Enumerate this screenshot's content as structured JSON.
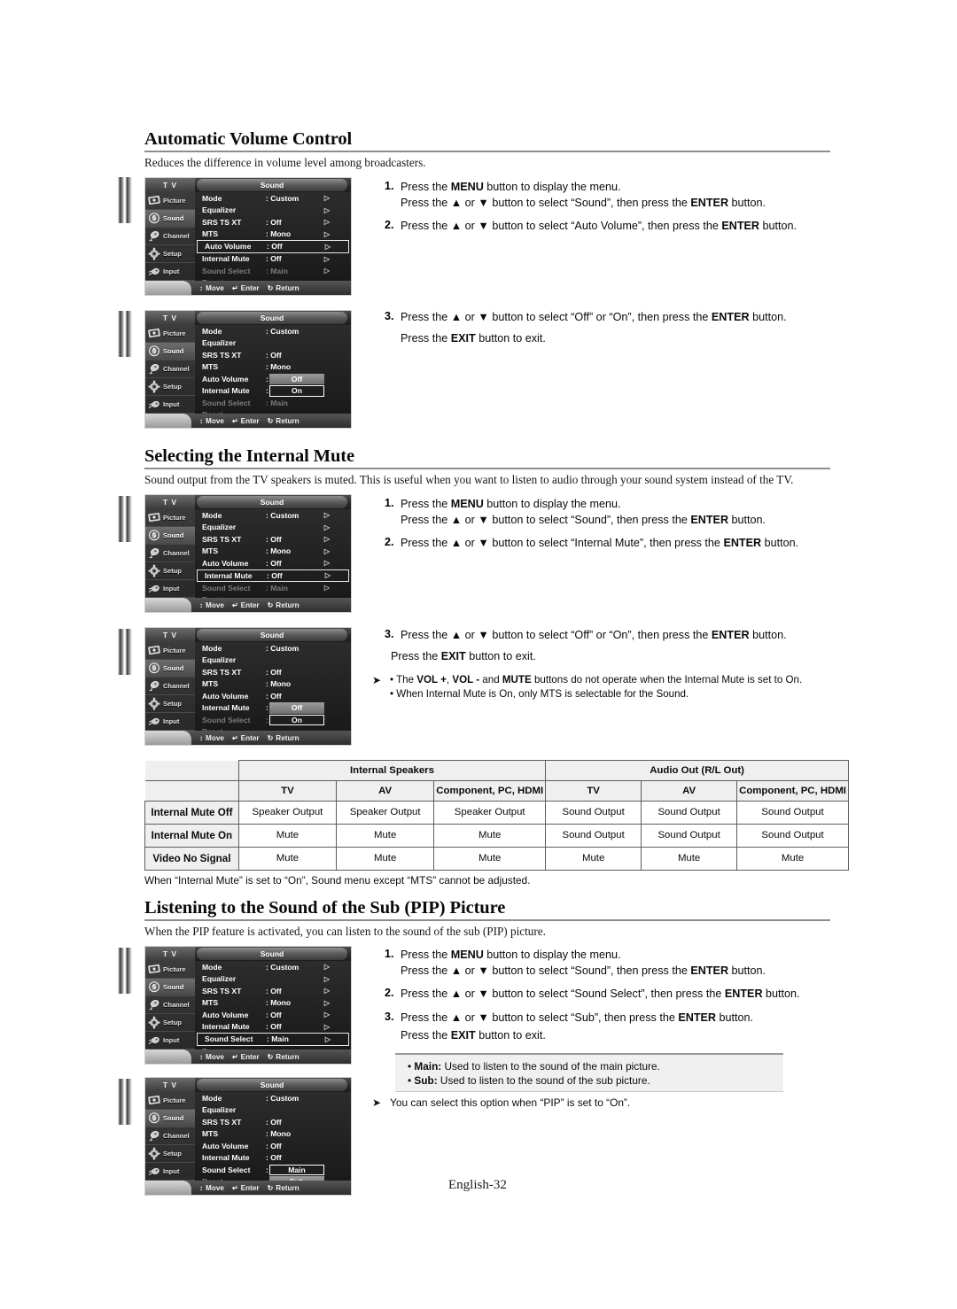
{
  "page": {
    "footer": "English-32"
  },
  "sections": [
    {
      "id": "avc",
      "heading": "Automatic Volume Control",
      "intro": "Reduces the difference in volume level among broadcasters.",
      "steps": [
        {
          "num": "1.",
          "lines": [
            "Press the MENU button to display the menu.",
            "Press the ▲ or ▼ button to select “Sound”, then press the ENTER button."
          ]
        },
        {
          "num": "2.",
          "lines": [
            "Press the ▲ or ▼ button to select “Auto Volume”, then press the ENTER button."
          ]
        },
        {
          "num": "3.",
          "lines": [
            "Press the ▲ or ▼ button to select “Off” or “On”, then press the ENTER button."
          ]
        }
      ],
      "exit_line": "Press the EXIT button to exit."
    },
    {
      "id": "mute",
      "heading": "Selecting the Internal Mute",
      "intro": "Sound output from the TV speakers is muted. This is useful when you want to listen to audio through your sound system instead of the TV.",
      "steps": [
        {
          "num": "1.",
          "lines": [
            "Press the MENU button to display the menu.",
            "Press the ▲ or ▼ button to select “Sound”, then press the ENTER button."
          ]
        },
        {
          "num": "2.",
          "lines": [
            "Press the ▲ or ▼ button to select “Internal Mute”, then press the ENTER button."
          ]
        },
        {
          "num": "3.",
          "lines": [
            "Press the ▲ or ▼ button to select “Off” or “On”, then press the ENTER button."
          ]
        }
      ],
      "exit_line": "Press the EXIT button to exit.",
      "notes": [
        "The VOL +, VOL - and MUTE buttons do not operate when the Internal Mute is set to On.",
        "When Internal Mute is On, only MTS is selectable for the Sound."
      ]
    },
    {
      "id": "pip",
      "heading": "Listening to the Sound of the Sub (PIP) Picture",
      "intro": "When the PIP feature is activated, you can listen to the sound of the sub (PIP) picture.",
      "steps": [
        {
          "num": "1.",
          "lines": [
            "Press the MENU button to display the menu.",
            "Press the ▲ or ▼ button to select “Sound”, then press the ENTER button."
          ]
        },
        {
          "num": "2.",
          "lines": [
            "Press the ▲ or ▼ button to select “Sound Select”, then press the ENTER button."
          ]
        },
        {
          "num": "3.",
          "lines": [
            "Press the ▲ or ▼ button to select “Sub”, then press the ENTER button."
          ]
        }
      ],
      "exit_line": "Press the EXIT button to exit.",
      "greybox": [
        {
          "term": "Main:",
          "text": " Used to listen to the sound of the main picture."
        },
        {
          "term": "Sub:",
          "text": " Used to listen to the sound of the sub picture."
        }
      ],
      "note": "You can select this option when “PIP” is set to “On”."
    }
  ],
  "osd": {
    "tv_label": "T V",
    "title": "Sound",
    "sidebar": [
      {
        "label": "Picture",
        "icon": "picture-icon",
        "selected": false
      },
      {
        "label": "Sound",
        "icon": "sound-icon",
        "selected": true
      },
      {
        "label": "Channel",
        "icon": "channel-icon",
        "selected": false
      },
      {
        "label": "Setup",
        "icon": "setup-icon",
        "selected": false
      },
      {
        "label": "Input",
        "icon": "input-icon",
        "selected": false
      }
    ],
    "rows": [
      {
        "key": "Mode",
        "value": ": Custom"
      },
      {
        "key": "Equalizer",
        "value": ""
      },
      {
        "key": "SRS TS XT",
        "value": ": Off"
      },
      {
        "key": "MTS",
        "value": ": Mono"
      },
      {
        "key": "Auto Volume",
        "value": ": Off"
      },
      {
        "key": "Internal Mute",
        "value": ": Off"
      },
      {
        "key": "Sound Select",
        "value": ": Main"
      },
      {
        "key": "Reset",
        "value": ""
      }
    ],
    "bottom": {
      "move": "Move",
      "enter": "Enter",
      "return": "Return"
    },
    "options": {
      "off": "Off",
      "on": "On",
      "main": "Main",
      "sub": "Sub"
    }
  },
  "menu_states": [
    {
      "id": "osd-1",
      "highlight_row": 4,
      "popup": null
    },
    {
      "id": "osd-2",
      "highlight_row": -1,
      "popup": {
        "rows": [
          4,
          5
        ],
        "items": [
          "Off",
          "On"
        ],
        "boxed_index": 1
      }
    },
    {
      "id": "osd-3",
      "highlight_row": 5,
      "popup": null
    },
    {
      "id": "osd-4",
      "highlight_row": -1,
      "popup": {
        "rows": [
          5,
          6
        ],
        "items": [
          "Off",
          "On"
        ],
        "boxed_index": 1
      }
    },
    {
      "id": "osd-5",
      "highlight_row": 6,
      "popup": null
    },
    {
      "id": "osd-6",
      "highlight_row": -1,
      "popup": {
        "rows": [
          6,
          7
        ],
        "items": [
          "Main",
          "Sub"
        ],
        "boxed_index": 0
      }
    }
  ],
  "table": {
    "group_headers": [
      "Internal Speakers",
      "Audio Out (R/L Out)"
    ],
    "sub_headers": [
      "TV",
      "AV",
      "Component, PC, HDMI",
      "TV",
      "AV",
      "Component, PC, HDMI"
    ],
    "rows": [
      {
        "label": "Internal Mute Off",
        "cells": [
          "Speaker Output",
          "Speaker Output",
          "Speaker Output",
          "Sound Output",
          "Sound Output",
          "Sound Output"
        ]
      },
      {
        "label": "Internal Mute On",
        "cells": [
          "Mute",
          "Mute",
          "Mute",
          "Sound Output",
          "Sound Output",
          "Sound Output"
        ]
      },
      {
        "label": "Video No Signal",
        "cells": [
          "Mute",
          "Mute",
          "Mute",
          "Mute",
          "Mute",
          "Mute"
        ]
      }
    ],
    "note": "When “Internal Mute” is set to “On”, Sound menu except “MTS” cannot be adjusted."
  }
}
